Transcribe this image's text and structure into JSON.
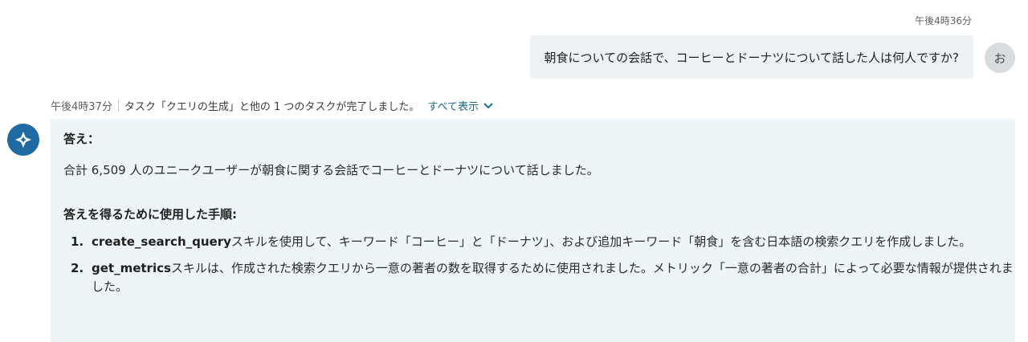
{
  "user_message": {
    "time": "午後4時36分",
    "text": "朝食についての会話で、コーヒーとドーナツについて話した人は何人ですか?",
    "avatar_initial": "お"
  },
  "status": {
    "time": "午後4時37分",
    "text": "タスク「クエリの生成」と他の 1 つのタスクが完了しました。",
    "show_all_label": "すべて表示"
  },
  "answer": {
    "heading": "答え：",
    "body": "合計 6,509 人のユニークユーザーが朝食に関する会話でコーヒーとドーナツについて話しました。",
    "steps_heading": "答えを得るために使用した手順:",
    "steps": [
      {
        "number": "1.",
        "skill": "create_search_query",
        "text": "スキルを使用して、キーワード「コーヒー」と「ドーナツ」、および追加キーワード「朝食」を含む日本語の検索クエリを作成しました。"
      },
      {
        "number": "2.",
        "skill": "get_metrics",
        "text": "スキルは、作成された検索クエリから一意の著者の数を取得するために使用されました。メトリック「一意の著者の合計」によって必要な情報が提供されました。"
      }
    ]
  },
  "colors": {
    "accent": "#1e6aa2",
    "link": "#1d6b8c",
    "answer_background": "#eef5f6",
    "user_bubble_background": "#eef1f3"
  },
  "icons": {
    "bot": "assistant-sparkle-icon",
    "show_all": "chevron-down-icon"
  }
}
